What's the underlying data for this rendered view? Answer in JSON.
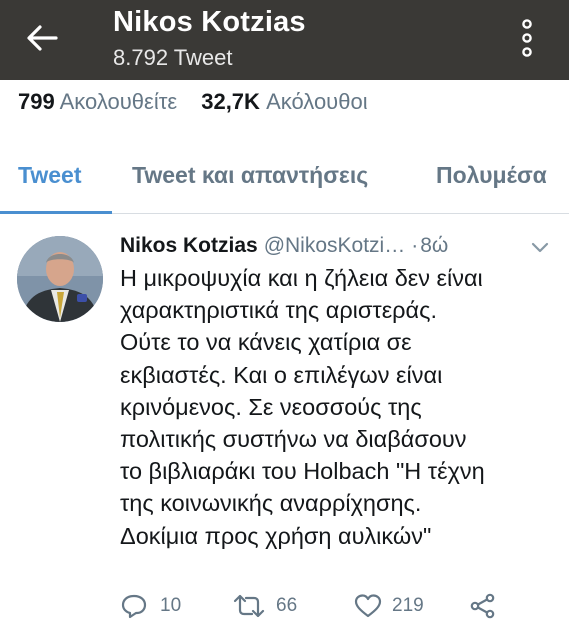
{
  "header": {
    "title": "Nikos Kotzias",
    "subtitle": "8.792 Tweet",
    "back_icon": "arrow-left-icon",
    "menu_icon": "more-vertical-icon"
  },
  "profile_stats": {
    "following_count": "799",
    "following_label": "Ακολουθείτε",
    "followers_count": "32,7K",
    "followers_label": "Ακόλουθοι"
  },
  "tabs": [
    {
      "label": "Tweet",
      "active": true
    },
    {
      "label": "Tweet και απαντήσεις",
      "active": false
    },
    {
      "label": "Πολυμέσα",
      "active": false
    }
  ],
  "tweet": {
    "author_name": "Nikos Kotzias",
    "handle": "@NikosKotzi…",
    "separator": "·",
    "time": "8ώ",
    "text_lines": [
      "Η μικροψυχία και η ζήλεια δεν είναι",
      "χαρακτηριστικά της αριστεράς.",
      "Ούτε το να κάνεις χατίρια σε",
      "εκβιαστές. Και ο επιλέγων είναι",
      "κρινόμενος. Σε νεοσσούς της",
      "πολιτικής συστήνω να διαβάσουν",
      "το βιβλιαράκι του Holbach \"Η τέχνη",
      "της κοινωνικής αναρρίχησης.",
      "Δοκίμια προς χρήση αυλικών\""
    ],
    "replies": "10",
    "retweets": "66",
    "likes": "219"
  },
  "colors": {
    "appbar_bg": "#3a3936",
    "accent": "#4a8fd0",
    "secondary_text": "#657786",
    "primary_text": "#14171a"
  }
}
